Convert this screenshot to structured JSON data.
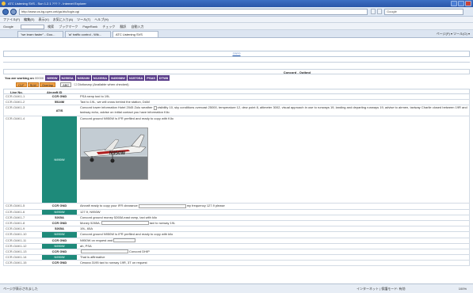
{
  "browser": {
    "title": "ATC Listening SVS - Sun 1.2.1 ??? ? - Internet Explorer",
    "url": "http://www.cs.bg.uyen.cnt/ga.btc/login.cgi",
    "search": "Google",
    "menu": [
      "ファイル(F)",
      "編集(E)",
      "表示(V)",
      "お気に入り(A)",
      "ツール(T)",
      "ヘルプ(H)"
    ],
    "toolbar": [
      "Google",
      "検索",
      "ブックマーク",
      "PageRank",
      "チェック",
      "翻訳",
      "自動入力"
    ],
    "tabs": [
      {
        "label": "\"we learn faster\" - Goo...",
        "active": false
      },
      {
        "label": "'ai' traffic control - Wik...",
        "active": false
      },
      {
        "label": "ATC Listening SVS",
        "active": true
      }
    ],
    "tab_tools": "ページ(P) ▾  ツール(O) ▾"
  },
  "page": {
    "top_link": "??/??",
    "route_title": "Concord - Outbnd",
    "working_label": "You are working on",
    "working_id": "00000",
    "callsign_chips": [
      "N950W",
      "N250SA",
      "N3524M",
      "N1235SA",
      "N45008W",
      "N1570SA",
      "PSA5",
      "DTW8"
    ],
    "buttons": [
      "CLF",
      "SLW",
      "Overlap"
    ],
    "helper_button": "ABC",
    "helper_note": "Dictionary (Available when checked)",
    "header": {
      "line": "Line No.",
      "aircraft": "Aircraft ID"
    },
    "rows": [
      {
        "id": "CCR-OAK1-1",
        "ac": "CCR GND",
        "msg": "PSA ramp taxi to 19L",
        "teal": false
      },
      {
        "id": "CCR-OAK1-2",
        "ac": "5524M",
        "msg": "Taxi to 19L, we will cross behind the station, DAM",
        "teal": false
      },
      {
        "id": "CCR-OAK1-3",
        "ac": "ATIS",
        "msg": "Concord tower information Hotel 2045 Zulu weather",
        "msg2": "visibility 10, sky conditions overcast 25000, temperature 12, dew point 8, altimeter 3002, visual approach in use to runways 19, landing and departing runways 19, advise to airmen, taxiway Charlie closed between 19R and taxiway echo, advise on initial contact you have information Kilo",
        "teal": false,
        "size": "med"
      },
      {
        "id": "CCR-OAK1-4",
        "ac": "N950W",
        "msg": "Concord ground N950W is IFR prefiled and ready to copy with Kilo",
        "teal": true,
        "size": "tall"
      },
      {
        "id": "CCR-OAK1-5",
        "ac": "CCR GND",
        "msg": "Aircraft ready to copy your IFR clearance",
        "msg2": "my frequency 127.9 please",
        "teal": false
      },
      {
        "id": "CCR-OAK1-6",
        "ac": "N950W",
        "msg": "127.9, N950W",
        "teal": true
      },
      {
        "id": "CCR-OAK1-7",
        "ac": "5265A",
        "msg": "Concord ground money 5265A east ramp, taxi with kilo",
        "teal": false
      },
      {
        "id": "CCR-OAK1-8",
        "ac": "CCR GND",
        "msg": "Money 5265A,",
        "msg2": "taxi to runway 19L",
        "teal": false
      },
      {
        "id": "CCR-OAK1-9",
        "ac": "5265A",
        "msg": "19L, 65A",
        "teal": false
      },
      {
        "id": "CCR-OAK1-10",
        "ac": "N950W",
        "msg": "Concord ground N950W is IFR prefiled and ready to copy with kilo",
        "teal": true
      },
      {
        "id": "CCR-OAK1-11",
        "ac": "CCR GND",
        "msg": "N950W on request and",
        "teal": false
      },
      {
        "id": "CCR-OAK1-12",
        "ac": "N950W",
        "msg": "ah, PSA",
        "teal": true
      },
      {
        "id": "CCR-OAK1-13",
        "ac": "CCR GND",
        "msg": "",
        "msg2": "Concord DHIP",
        "teal": false
      },
      {
        "id": "CCR-OAK1-14",
        "ac": "N950W",
        "msg": "That is affirmative",
        "teal": true
      },
      {
        "id": "CCR-OAK1-15",
        "ac": "CCR GND",
        "msg": "Cessna 3195 taxi to runway 19R, 3T on request",
        "teal": false
      }
    ],
    "photo_caption": "N950W"
  },
  "status": {
    "left": "ページが表示されました",
    "zone": "インターネット | 保護モード: 有効",
    "zoom": "100%"
  },
  "colors": {
    "teal": "#1e8a7a",
    "purple_chip": "#5a3d8a",
    "orange_button": "#f2a349"
  }
}
